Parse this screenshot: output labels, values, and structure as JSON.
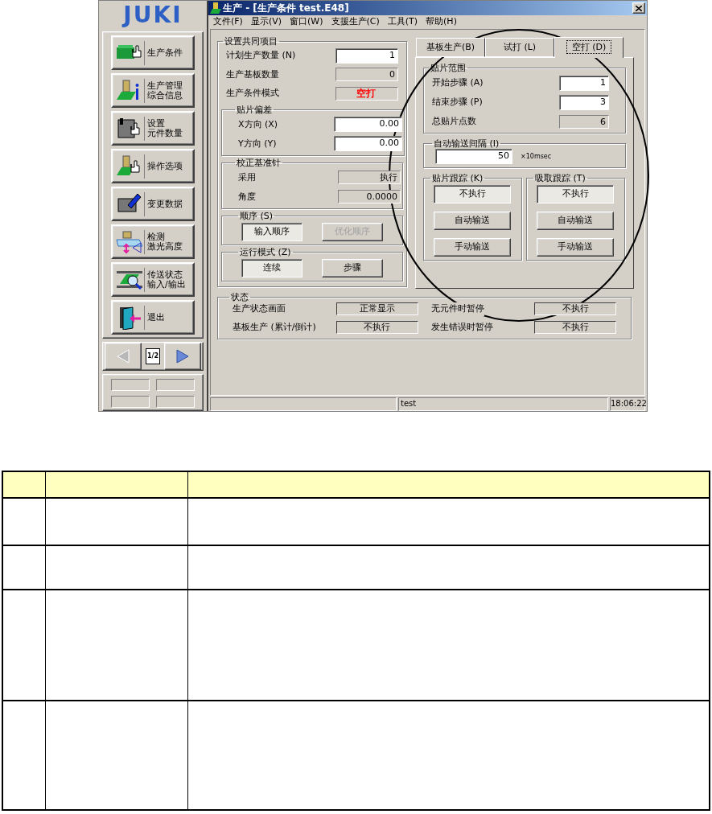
{
  "sidebar": {
    "logo": "JUKI",
    "buttons": [
      {
        "lines": [
          "生产条件"
        ]
      },
      {
        "lines": [
          "生产管理",
          "综合信息"
        ]
      },
      {
        "lines": [
          "设置",
          "元件数量"
        ]
      },
      {
        "lines": [
          "操作选项"
        ]
      },
      {
        "lines": [
          "变更数据"
        ]
      },
      {
        "lines": [
          "检测",
          "激光高度"
        ]
      },
      {
        "lines": [
          "传送状态",
          "输入/输出"
        ]
      },
      {
        "lines": [
          "退出"
        ]
      }
    ],
    "pager": {
      "label": "1/2",
      "prev": {
        "disabled": true
      },
      "next": {
        "disabled": false
      }
    }
  },
  "window": {
    "title": "生产 - [生产条件 test.E48]"
  },
  "menu": [
    "文件(F)",
    "显示(V)",
    "窗口(W)",
    "支援生产(C)",
    "工具(T)",
    "帮助(H)"
  ],
  "common": {
    "title": "设置共同项目",
    "fields": [
      {
        "label": "计划生产数量 (N)",
        "value": "1",
        "kind": "input"
      },
      {
        "label": "生产基板数量",
        "value": "0",
        "kind": "readonly"
      },
      {
        "label": "生产条件模式",
        "value": "空打",
        "kind": "readonly",
        "color": "#ff0000"
      }
    ],
    "offset": {
      "title": "贴片偏差",
      "fields": [
        {
          "label": "X方向 (X)",
          "value": "0.00",
          "kind": "input"
        },
        {
          "label": "Y方向 (Y)",
          "value": "0.00",
          "kind": "input"
        }
      ]
    },
    "pin": {
      "title": "校正基准针",
      "fields": [
        {
          "label": "采用",
          "value": "执行",
          "kind": "readonly"
        },
        {
          "label": "角度",
          "value": "0.0000",
          "kind": "readonly"
        }
      ]
    },
    "order": {
      "title": "顺序 (S)",
      "buttons": [
        {
          "label": "输入顺序",
          "selected": true,
          "disabled": false
        },
        {
          "label": "优化顺序",
          "selected": false,
          "disabled": true
        }
      ]
    },
    "mode": {
      "title": "运行模式 (Z)",
      "buttons": [
        {
          "label": "连续",
          "selected": true,
          "disabled": false
        },
        {
          "label": "步骤",
          "selected": false,
          "disabled": false
        }
      ]
    }
  },
  "tabs": [
    {
      "label": "基板生产(B)",
      "selected": false
    },
    {
      "label": "试打 (L)",
      "selected": false
    },
    {
      "label": "空打 (D)",
      "selected": true
    }
  ],
  "range": {
    "title": "贴片范围",
    "fields": [
      {
        "label": "开始步骤 (A)",
        "value": "1",
        "kind": "input"
      },
      {
        "label": "结束步骤 (P)",
        "value": "3",
        "kind": "input"
      },
      {
        "label": "总贴片点数",
        "value": "6",
        "kind": "readonly"
      }
    ]
  },
  "interval": {
    "title": "自动输送间隔 (I)",
    "value": "50",
    "unit": "×10msec"
  },
  "tracking": [
    {
      "title": "贴片跟踪 (K)",
      "buttons": [
        {
          "label": "不执行",
          "selected": true
        },
        {
          "label": "自动输送",
          "selected": false
        },
        {
          "label": "手动输送",
          "selected": false
        }
      ]
    },
    {
      "title": "吸取跟踪 (T)",
      "buttons": [
        {
          "label": "不执行",
          "selected": true
        },
        {
          "label": "自动输送",
          "selected": false
        },
        {
          "label": "手动输送",
          "selected": false
        }
      ]
    }
  ],
  "status": {
    "title": "状态",
    "items": [
      {
        "label": "生产状态画面",
        "value": "正常显示"
      },
      {
        "label": "无元件时暂停",
        "value": "不执行"
      },
      {
        "label": "基板生产 (累计/倒计)",
        "value": "不执行"
      },
      {
        "label": "发生错误时暂停",
        "value": "不执行"
      }
    ]
  },
  "status_bar": {
    "file": "test",
    "time": "18:06:22"
  }
}
